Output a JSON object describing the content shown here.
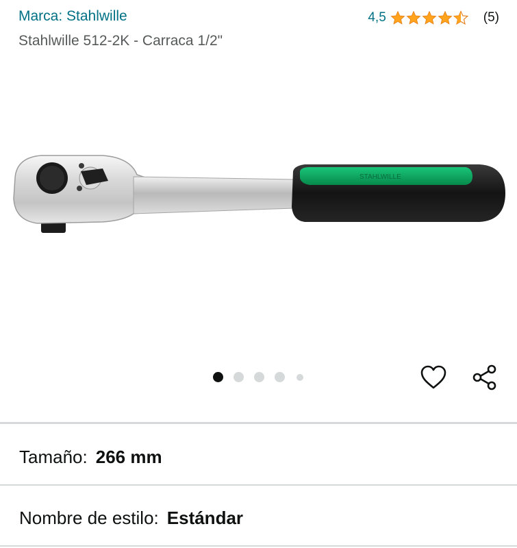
{
  "product": {
    "brand": "Marca: Stahlwille",
    "title": "Stahlwille 512-2K - Carraca 1/2\"",
    "rating_value": "4,5",
    "rating_stars": 4.5,
    "review_count": "(5)",
    "image_marking": "STAHLWILLE"
  },
  "carousel": {
    "page_count": 5,
    "active_index": 0
  },
  "variations": {
    "size_label": "Tamaño:",
    "size_value": "266 mm",
    "style_label": "Nombre de estilo:",
    "style_value": "Estándar"
  },
  "colors": {
    "link": "#007185",
    "star": "#ffa41c",
    "handle_green": "#0aa860",
    "divider": "#d5d9d9"
  },
  "icons": {
    "wishlist": "heart-icon",
    "share": "share-icon"
  }
}
